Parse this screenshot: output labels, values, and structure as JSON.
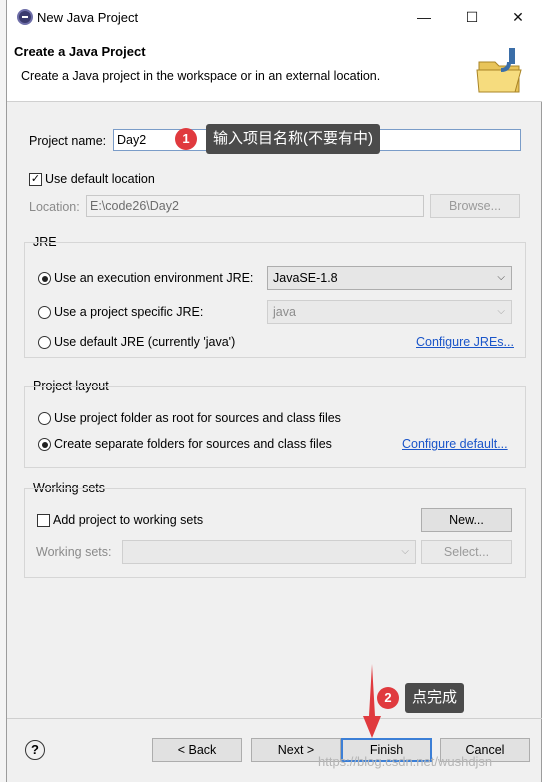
{
  "window": {
    "title": "New Java Project",
    "controls": {
      "minimize": "—",
      "maximize": "☐",
      "close": "✕"
    }
  },
  "header": {
    "title": "Create a Java Project",
    "description": "Create a Java project in the workspace or in an external location."
  },
  "project_name": {
    "label": "Project name:",
    "value": "Day2"
  },
  "location": {
    "use_default_label": "Use default location",
    "use_default_checked": true,
    "label": "Location:",
    "value": "E:\\code26\\Day2",
    "browse_label": "Browse..."
  },
  "jre": {
    "group_title": "JRE",
    "options": [
      {
        "label": "Use an execution environment JRE:",
        "selected": true,
        "combo": "JavaSE-1.8"
      },
      {
        "label": "Use a project specific JRE:",
        "selected": false,
        "combo": "java"
      },
      {
        "label": "Use default JRE (currently 'java')",
        "selected": false
      }
    ],
    "configure_link": "Configure JREs..."
  },
  "layout": {
    "group_title": "Project layout",
    "options": [
      {
        "label": "Use project folder as root for sources and class files",
        "selected": false
      },
      {
        "label": "Create separate folders for sources and class files",
        "selected": true
      }
    ],
    "configure_link": "Configure default..."
  },
  "working_sets": {
    "group_title": "Working sets",
    "add_label": "Add project to working sets",
    "add_checked": false,
    "new_label": "New...",
    "sets_label": "Working sets:",
    "select_label": "Select..."
  },
  "buttons": {
    "help": "?",
    "back": "< Back",
    "next": "Next >",
    "finish": "Finish",
    "cancel": "Cancel"
  },
  "annotations": {
    "step1_badge": "1",
    "step1_text": "输入项目名称(不要有中)",
    "step2_badge": "2",
    "step2_text": "点完成"
  },
  "watermark": "https://blog.csdn.net/wushdjsn",
  "colors": {
    "annotation_red": "#e03a3e",
    "tooltip_bg": "#4b4b4b",
    "link": "#1a55c9",
    "default_button_border": "#3c7fd6"
  }
}
